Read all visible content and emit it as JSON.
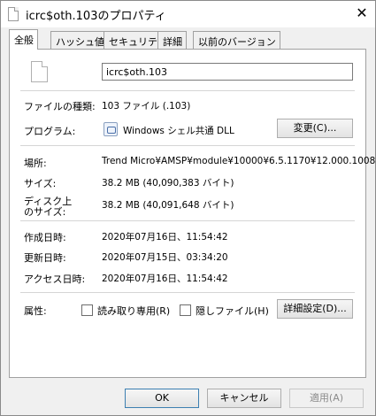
{
  "window": {
    "title": "icrc$oth.103のプロパティ",
    "close_glyph": "✕"
  },
  "tabs": [
    {
      "label": "全般",
      "active": true
    },
    {
      "label": "ハッシュ値",
      "active": false
    },
    {
      "label": "セキュリティ",
      "active": false
    },
    {
      "label": "詳細",
      "active": false
    },
    {
      "label": "以前のバージョン",
      "active": false
    }
  ],
  "general": {
    "file_name": "icrc$oth.103",
    "file_type_label": "ファイルの種類:",
    "file_type_value": "103 ファイル (.103)",
    "program_label": "プログラム:",
    "program_value": "Windows シェル共通 DLL",
    "change_button": "変更(C)...",
    "location_label": "場所:",
    "location_value": "Trend Micro¥AMSP¥module¥10000¥6.5.1170¥12.000.1008",
    "size_label": "サイズ:",
    "size_value": "38.2 MB (40,090,383 バイト)",
    "disk_size_label_1": "ディスク上",
    "disk_size_label_2": "のサイズ:",
    "disk_size_value": "38.2 MB (40,091,648 バイト)",
    "created_label": "作成日時:",
    "created_value": "2020年07月16日、11:54:42",
    "modified_label": "更新日時:",
    "modified_value": "2020年07月15日、03:34:20",
    "accessed_label": "アクセス日時:",
    "accessed_value": "2020年07月16日、11:54:42",
    "attributes_label": "属性:",
    "readonly_label": "読み取り専用(R)",
    "hidden_label": "隠しファイル(H)",
    "advanced_button": "詳細設定(D)..."
  },
  "footer": {
    "ok": "OK",
    "cancel": "キャンセル",
    "apply": "適用(A)"
  },
  "icons": {
    "title": "document-icon",
    "file": "blank-file-icon",
    "program": "shell-dll-icon"
  }
}
